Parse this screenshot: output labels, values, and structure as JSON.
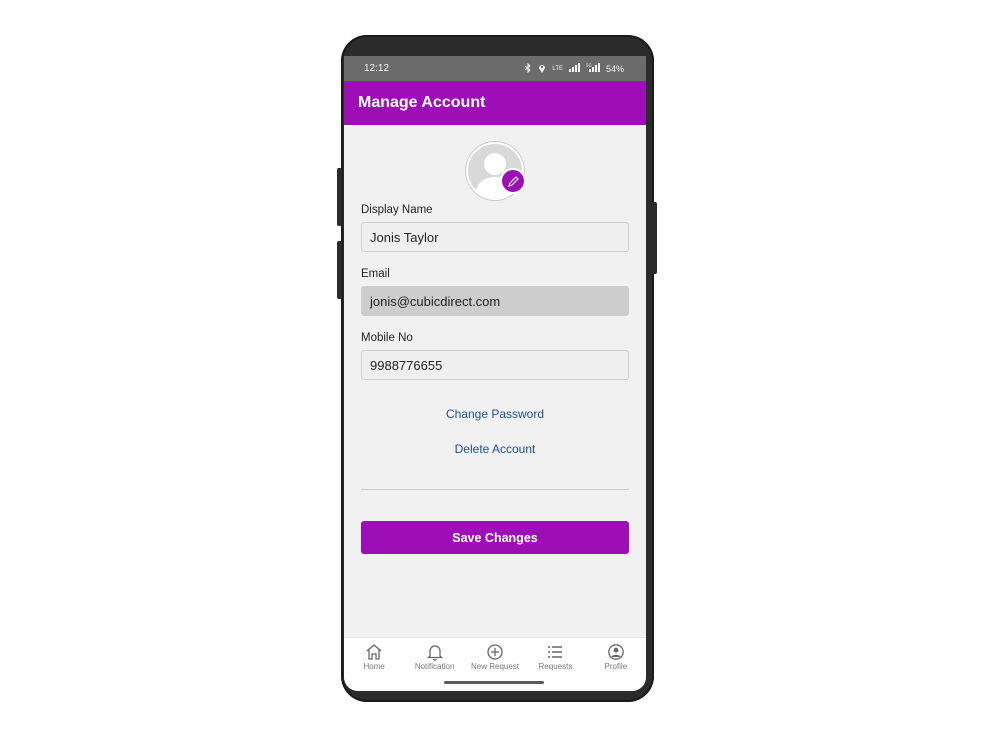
{
  "status_bar": {
    "time": "12:12",
    "battery": "54%",
    "icons": [
      "bluetooth-icon",
      "location-icon",
      "volte-icon",
      "signal-icon",
      "5g-signal-icon"
    ]
  },
  "app_bar": {
    "title": "Manage Account"
  },
  "avatar": {
    "icon": "person-silhouette",
    "edit_icon": "pencil-icon"
  },
  "form": {
    "display_name": {
      "label": "Display Name",
      "value": "Jonis Taylor"
    },
    "email": {
      "label": "Email",
      "value": "jonis@cubicdirect.com"
    },
    "mobile": {
      "label": "Mobile No",
      "value": "9988776655"
    }
  },
  "links": {
    "change_password": "Change Password",
    "delete_account": "Delete Account"
  },
  "save_button": "Save Changes",
  "bottom_nav": {
    "items": [
      {
        "label": "Home",
        "icon": "home-icon"
      },
      {
        "label": "Notification",
        "icon": "bell-icon"
      },
      {
        "label": "New Request",
        "icon": "plus-circle-icon"
      },
      {
        "label": "Requests",
        "icon": "list-icon"
      },
      {
        "label": "Profile",
        "icon": "profile-icon"
      }
    ]
  },
  "colors": {
    "accent": "#9e0eb6",
    "link": "#1f4f86",
    "status_bar": "#6b6b6b",
    "background": "#f1f1f1"
  }
}
